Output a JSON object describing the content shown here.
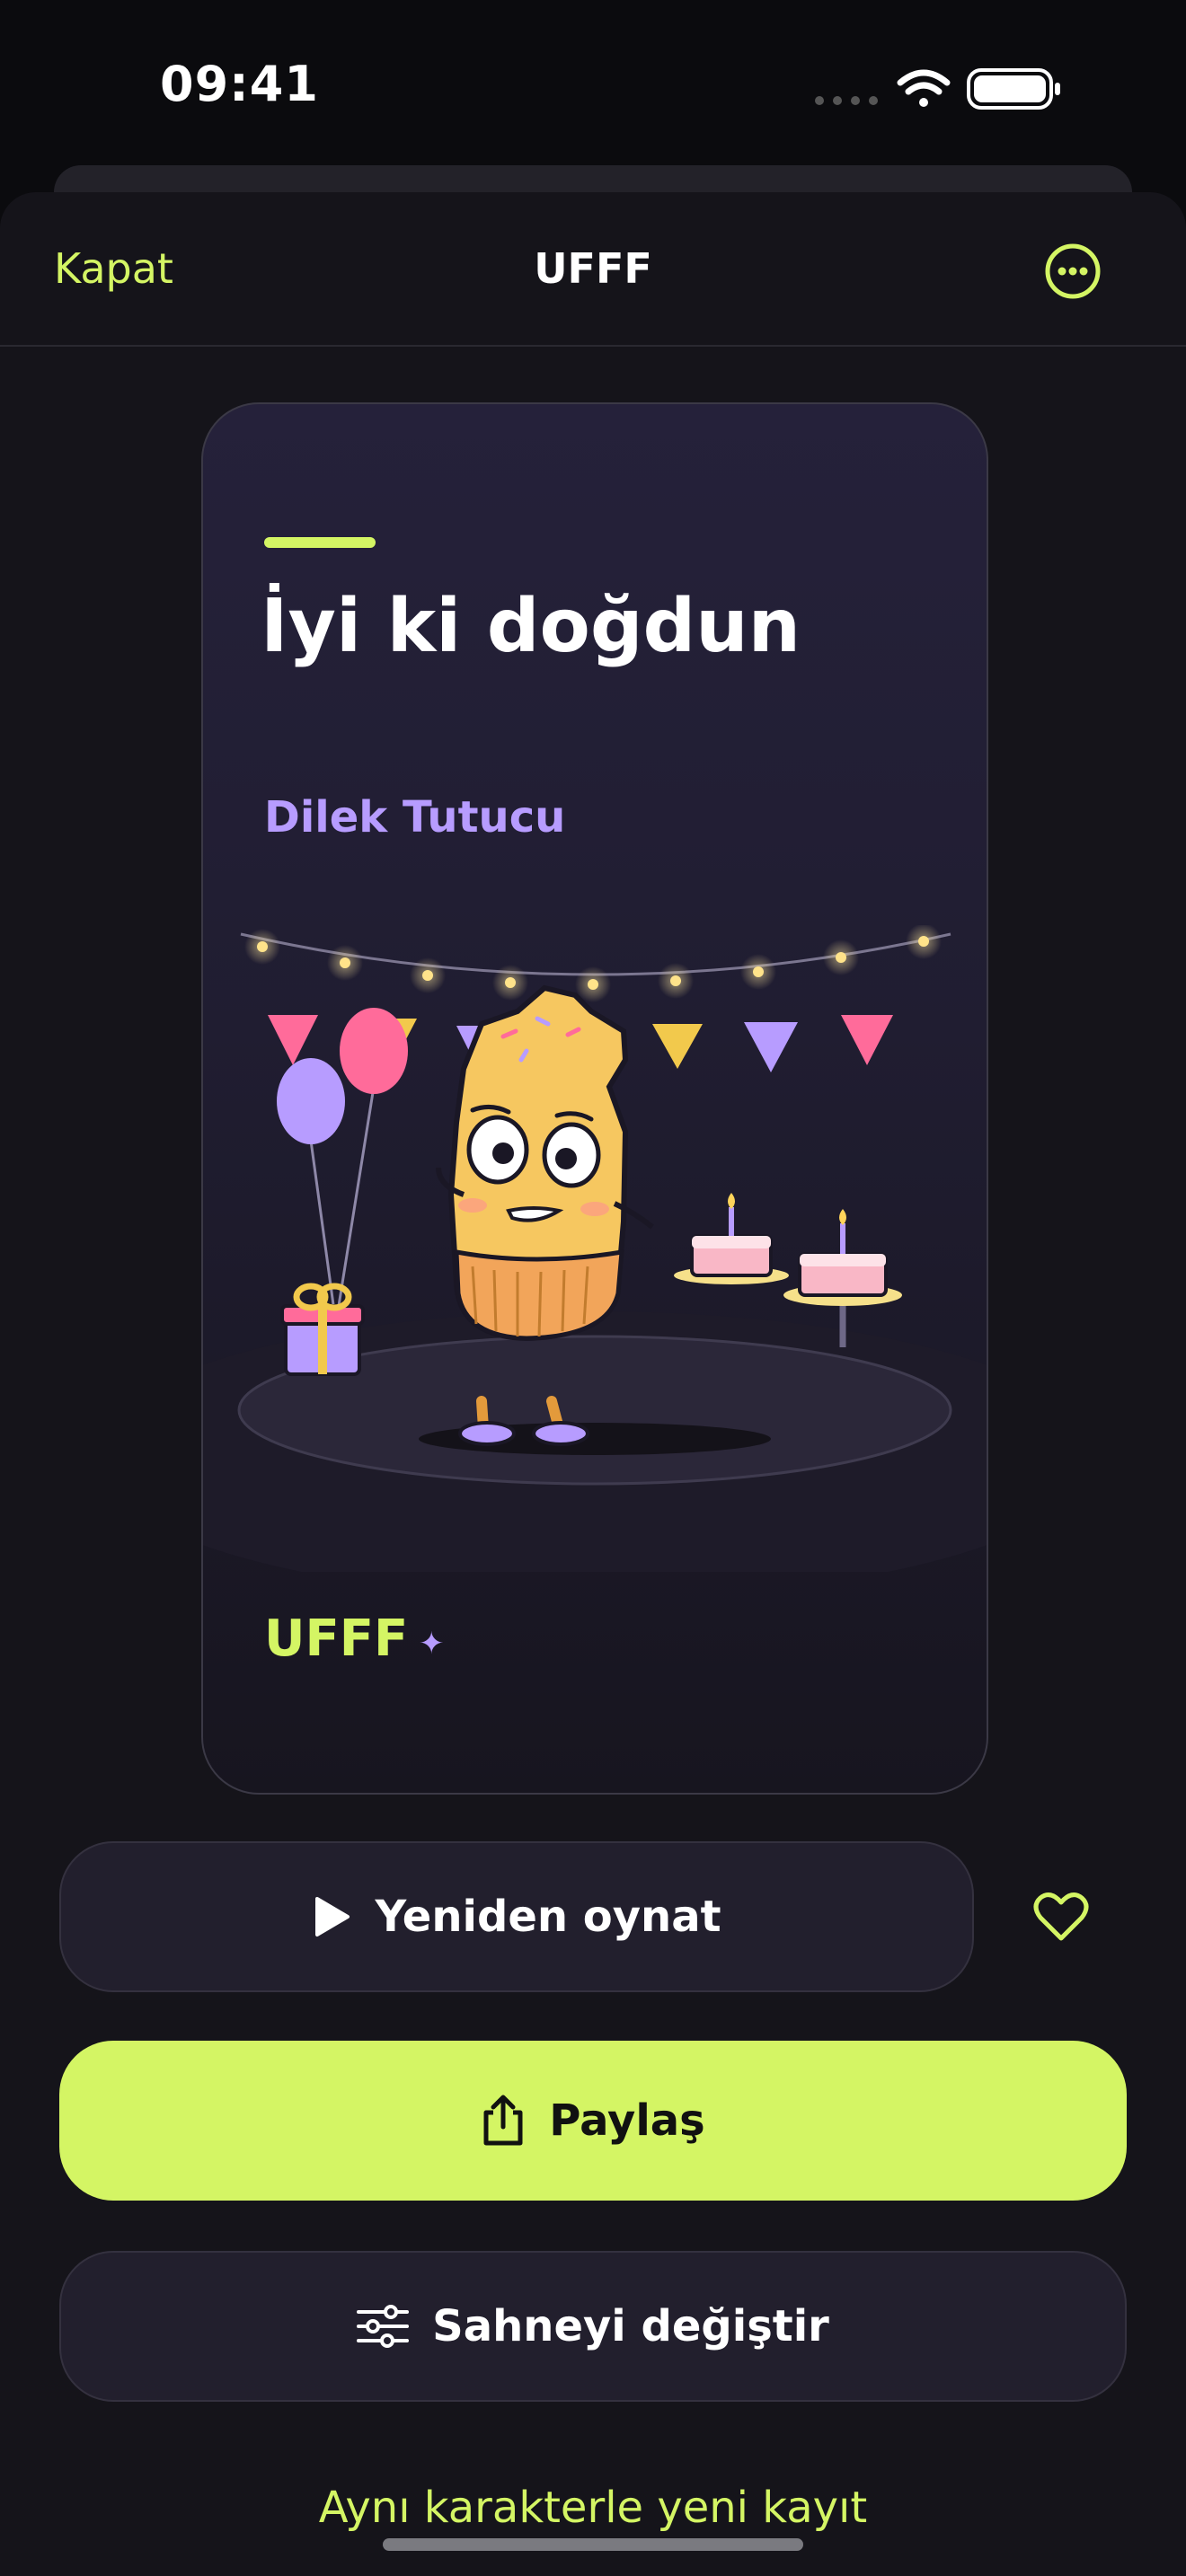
{
  "status_bar": {
    "time": "09:41",
    "icons": [
      "signal-icon",
      "wifi-icon",
      "battery-icon"
    ]
  },
  "nav": {
    "close_label": "Kapat",
    "title": "UFFF",
    "more_icon": "ellipsis-circle-icon"
  },
  "card": {
    "title": "İyi ki doğdun",
    "subtitle": "Dilek Tutucu",
    "brand": "UFFF",
    "sparkle": "✦"
  },
  "actions": {
    "replay_label": "Yeniden oynat",
    "favorite_icon": "heart-icon",
    "share_label": "Paylaş",
    "change_scene_label": "Sahneyi değiştir",
    "new_recording_label": "Aynı karakterle yeni kayıt"
  },
  "colors": {
    "accent": "#d4f564",
    "lavender": "#b79cff",
    "pink": "#ff6b9a",
    "background": "#0b0b0e"
  }
}
